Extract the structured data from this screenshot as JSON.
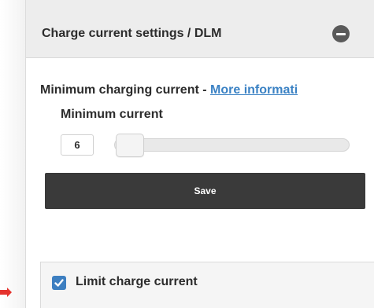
{
  "panel": {
    "title": "Charge current settings / DLM"
  },
  "min_charging": {
    "label": "Minimum charging current - ",
    "link_text": "More informati"
  },
  "min_current": {
    "label": "Minimum current",
    "value": "6"
  },
  "save": {
    "label": "Save"
  },
  "limit_charge": {
    "label": "Limit charge current",
    "checked": true
  },
  "colors": {
    "header_bg": "#ededed",
    "save_bg": "#3a3a3a",
    "link": "#3b82c4",
    "checkbox": "#3d7fc1",
    "arrow": "#e5322d"
  },
  "icons": {
    "collapse": "minus-circle-icon",
    "check": "checkmark-icon",
    "pointer": "arrow-right-icon"
  }
}
